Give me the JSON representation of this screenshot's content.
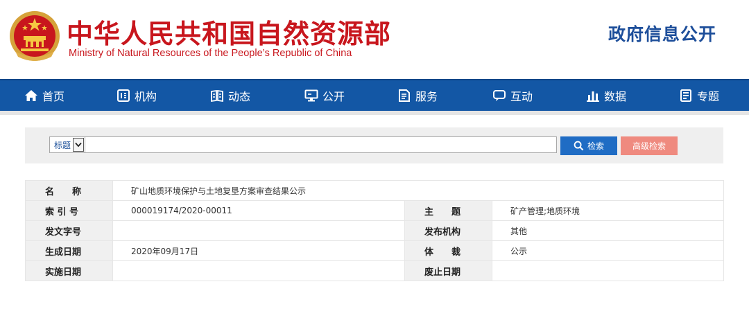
{
  "header": {
    "title_cn": "中华人民共和国自然资源部",
    "title_en": "Ministry of Natural Resources of the People’s Republic of China",
    "gov_open": "政府信息公开",
    "emblem_icon": "national-emblem-icon"
  },
  "colors": {
    "brand_red": "#c8161d",
    "nav_blue": "#1357a5",
    "search_blue": "#1f6cc4",
    "advanced_pink": "#ef8a7f"
  },
  "nav": {
    "items": [
      {
        "label": "首页",
        "icon": "home-icon"
      },
      {
        "label": "机构",
        "icon": "org-icon"
      },
      {
        "label": "动态",
        "icon": "news-icon"
      },
      {
        "label": "公开",
        "icon": "monitor-icon"
      },
      {
        "label": "服务",
        "icon": "document-icon"
      },
      {
        "label": "互动",
        "icon": "chat-icon"
      },
      {
        "label": "数据",
        "icon": "bar-chart-icon"
      },
      {
        "label": "专题",
        "icon": "book-icon"
      }
    ]
  },
  "search": {
    "field_selected": "标题",
    "input_value": "",
    "search_label": "检索",
    "advanced_label": "高级检索"
  },
  "info": {
    "name_label": "名　　称",
    "name_value": "矿山地质环境保护与土地复垦方案审查结果公示",
    "index_label": "索 引 号",
    "index_value": "000019174/2020-00011",
    "theme_label": "主　　题",
    "theme_value": "矿产管理;地质环境",
    "docno_label": "发文字号",
    "docno_value": "",
    "publisher_label": "发布机构",
    "publisher_value": "其他",
    "date_label": "生成日期",
    "date_value": "2020年09月17日",
    "genre_label": "体　　裁",
    "genre_value": "公示",
    "effective_label": "实施日期",
    "effective_value": "",
    "expire_label": "废止日期",
    "expire_value": ""
  }
}
